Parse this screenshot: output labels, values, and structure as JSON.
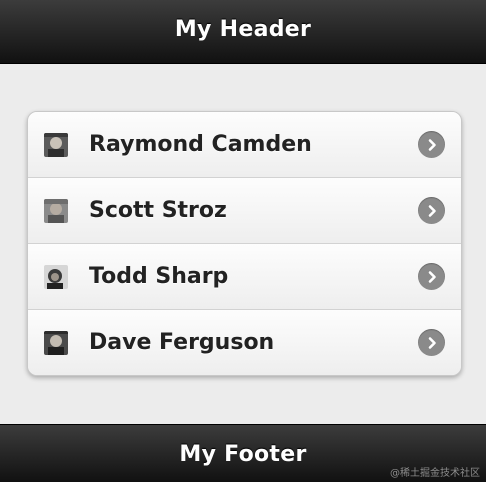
{
  "header": {
    "title": "My Header"
  },
  "list": {
    "items": [
      {
        "name": "Raymond Camden",
        "avatar": "avatar-raymond"
      },
      {
        "name": "Scott Stroz",
        "avatar": "avatar-scott"
      },
      {
        "name": "Todd Sharp",
        "avatar": "avatar-todd"
      },
      {
        "name": "Dave Ferguson",
        "avatar": "avatar-dave"
      }
    ],
    "arrow_icon": "chevron-right-circle-icon"
  },
  "footer": {
    "title": "My Footer"
  },
  "watermark": {
    "text": "@稀土掘金技术社区"
  },
  "colors": {
    "bar": "#1e1e1e",
    "background": "#ececec",
    "arrow": "#8a8a8a",
    "label": "#222222"
  }
}
